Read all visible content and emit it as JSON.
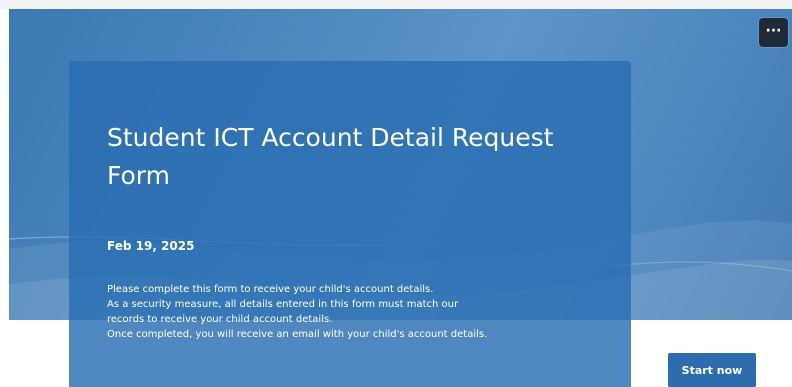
{
  "toolbar": {
    "more_label": "···"
  },
  "form": {
    "title": "Student ICT Account Detail Request Form",
    "date": "Feb 19, 2025",
    "description_lines": [
      "Please complete this form to receive your child's account details.",
      "As a security measure, all details entered in this form must match our",
      "records to receive your child account details.",
      "Once completed, you will receive an email with your child's account details."
    ],
    "start_label": "Start now"
  },
  "colors": {
    "hero_background": "#4f89c0",
    "card_background": "#286eb2",
    "button_background": "#2d6cae",
    "more_button_background": "#1f2a36",
    "text": "#ffffff"
  },
  "icons": {
    "more": "more-options-icon"
  }
}
